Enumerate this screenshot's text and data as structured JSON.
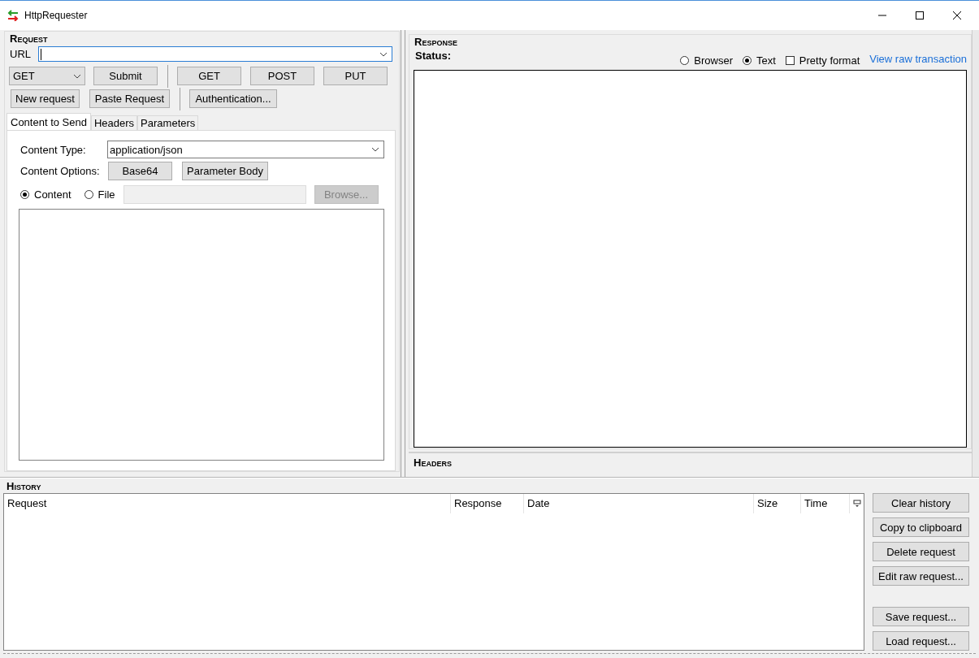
{
  "window": {
    "title": "HttpRequester"
  },
  "request": {
    "title": "Request",
    "url_label": "URL",
    "method_select": "GET",
    "submit": "Submit",
    "quick_methods": [
      "GET",
      "POST",
      "PUT"
    ],
    "actions": [
      "New request",
      "Paste Request"
    ],
    "auth": "Authentication...",
    "tabs": [
      {
        "label": "Content to Send",
        "selected": true
      },
      {
        "label": "Headers",
        "selected": false
      },
      {
        "label": "Parameters",
        "selected": false
      }
    ],
    "content_type": {
      "label": "Content Type:",
      "value": "application/json"
    },
    "content_options": {
      "label": "Content Options:",
      "buttons": [
        "Base64",
        "Parameter Body"
      ]
    },
    "sources": [
      {
        "label": "Content",
        "selected": true
      },
      {
        "label": "File",
        "selected": false
      }
    ],
    "browse": {
      "label": "Browse...",
      "disabled": true
    }
  },
  "response": {
    "title": "Response",
    "status_label": "Status:",
    "view_modes": [
      {
        "label": "Browser",
        "selected": false
      },
      {
        "label": "Text",
        "selected": true
      }
    ],
    "pretty_format": {
      "label": "Pretty format",
      "checked": false
    },
    "raw_link": "View raw transaction",
    "headers_title": "Headers"
  },
  "history": {
    "title": "History",
    "columns": [
      "Request",
      "Response",
      "Date",
      "Size",
      "Time"
    ],
    "button_groups": [
      {
        "buttons": [
          "Clear history",
          "Copy to clipboard",
          "Delete request",
          "Edit raw request..."
        ]
      },
      {
        "buttons": [
          "Save request...",
          "Load request..."
        ]
      }
    ]
  }
}
